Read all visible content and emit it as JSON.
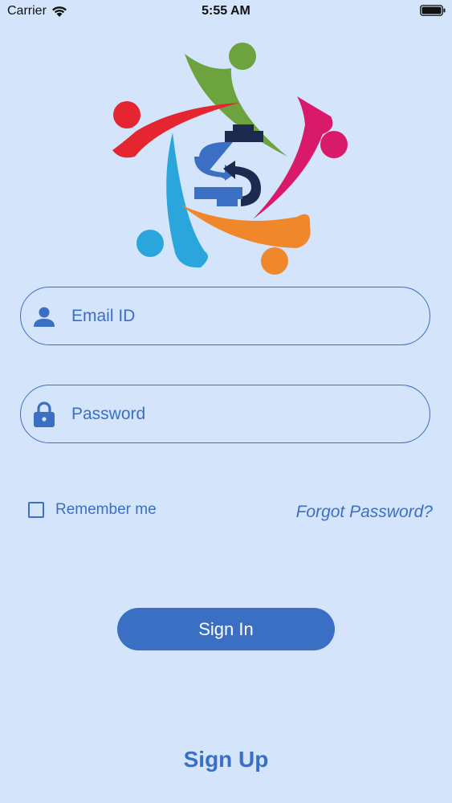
{
  "status_bar": {
    "carrier": "Carrier",
    "time": "5:55 AM"
  },
  "form": {
    "email_placeholder": "Email ID",
    "password_placeholder": "Password",
    "remember_label": "Remember me",
    "forgot_label": "Forgot Password?",
    "signin_label": "Sign In",
    "signup_label": "Sign Up"
  },
  "icons": {
    "email": "person-icon",
    "password": "lock-icon"
  },
  "colors": {
    "background": "#d4e4fb",
    "accent": "#3a6fc4"
  }
}
